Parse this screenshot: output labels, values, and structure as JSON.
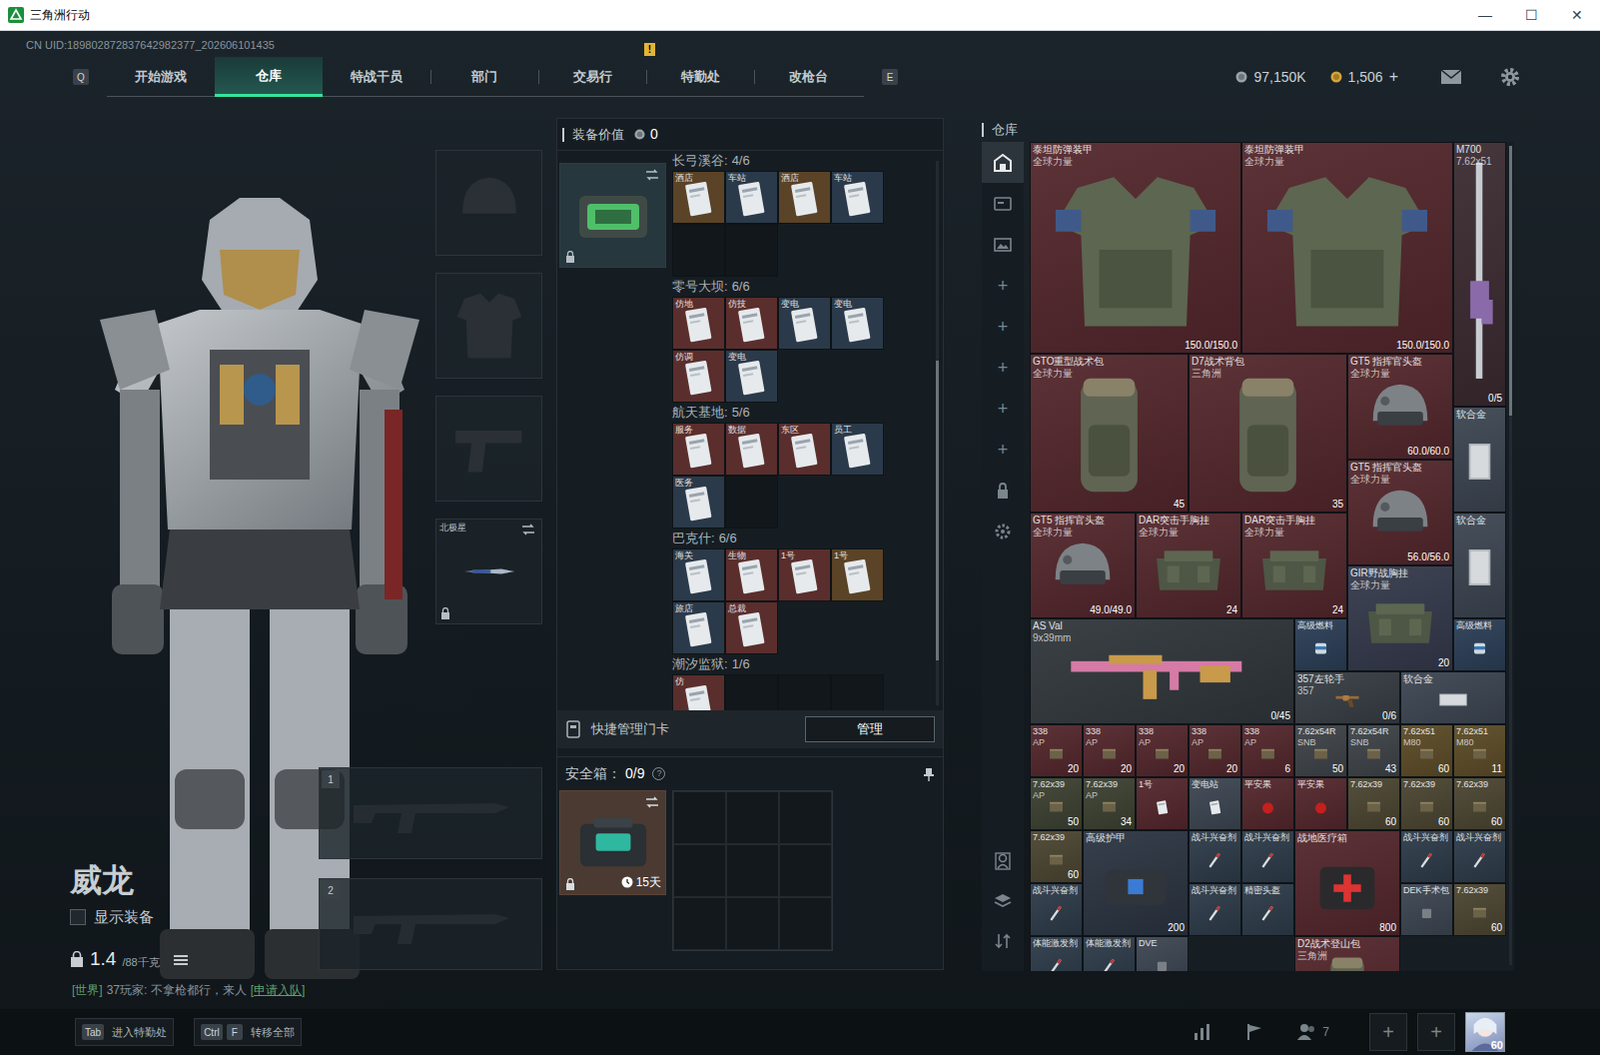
{
  "window": {
    "title": "三角洲行动",
    "controls": [
      "—",
      "☐",
      "✕"
    ]
  },
  "uid": "CN UID:189802872837642982377_202606101435",
  "nav": {
    "left_key": "Q",
    "right_key": "E",
    "tabs": [
      {
        "label": "开始游戏",
        "selected": false,
        "badge": ""
      },
      {
        "label": "仓库",
        "selected": true,
        "badge": ""
      },
      {
        "label": "特战干员",
        "selected": false,
        "badge": ""
      },
      {
        "label": "部门",
        "selected": false,
        "badge": ""
      },
      {
        "label": "交易行",
        "selected": false,
        "badge": ""
      },
      {
        "label": "特勤处",
        "selected": false,
        "badge": "!"
      },
      {
        "label": "改枪台",
        "selected": false,
        "badge": ""
      }
    ]
  },
  "currency": {
    "coins": "97,150K",
    "tickets": "1,506",
    "add": "+"
  },
  "character": {
    "name": "威龙",
    "show_equipment": {
      "label": "显示装备",
      "checked": false
    },
    "weight": "1.4",
    "weight_max": "/88千克"
  },
  "chat": {
    "channel": "[世界]",
    "text": "37玩家: 不拿枪都行，来人",
    "action": "[申请入队]"
  },
  "equipment": {
    "slots": [
      {
        "kind": "helmet",
        "label": "",
        "locked": false
      },
      {
        "kind": "armor",
        "label": "",
        "locked": false
      },
      {
        "kind": "pistol",
        "label": "",
        "locked": false
      },
      {
        "kind": "melee",
        "label": "北极星",
        "locked": true
      }
    ],
    "weapon_slots": [
      {
        "label": "1"
      },
      {
        "label": "2"
      }
    ]
  },
  "loadout": {
    "title": "装备价值",
    "value": "0",
    "keycards": {
      "title": "快捷管理门卡",
      "button": "管理",
      "sections": [
        {
          "title": "长弓溪谷:",
          "count": "4/6",
          "empty_slots": 2,
          "cards": [
            {
              "label": "酒店",
              "color": "#5a4326"
            },
            {
              "label": "车站",
              "color": "#2b3a4a"
            },
            {
              "label": "酒店",
              "color": "#5a4326"
            },
            {
              "label": "车站",
              "color": "#2b3a4a"
            }
          ]
        },
        {
          "title": "零号大坝:",
          "count": "6/6",
          "empty_slots": 0,
          "cards": [
            {
              "label": "仿地",
              "color": "#5a2e2c"
            },
            {
              "label": "仿技",
              "color": "#5a2e2c"
            },
            {
              "label": "变电",
              "color": "#2b3a4a"
            },
            {
              "label": "变电",
              "color": "#2b3a4a"
            },
            {
              "label": "仿调",
              "color": "#5a2e2c"
            },
            {
              "label": "变电",
              "color": "#2b3a4a"
            }
          ]
        },
        {
          "title": "航天基地:",
          "count": "5/6",
          "empty_slots": 1,
          "cards": [
            {
              "label": "服务",
              "color": "#5a2e2c"
            },
            {
              "label": "数据",
              "color": "#5a2e2c"
            },
            {
              "label": "东区",
              "color": "#5a2e2c"
            },
            {
              "label": "员工",
              "color": "#2b3a4a"
            },
            {
              "label": "医务",
              "color": "#2b3a4a"
            }
          ]
        },
        {
          "title": "巴克什:",
          "count": "6/6",
          "empty_slots": 0,
          "cards": [
            {
              "label": "海关",
              "color": "#2b3a4a"
            },
            {
              "label": "生物",
              "color": "#5a2e2c"
            },
            {
              "label": "1号",
              "color": "#5a2e2c"
            },
            {
              "label": "1号",
              "color": "#5a4326"
            },
            {
              "label": "旅店",
              "color": "#2b3a4a"
            },
            {
              "label": "总裁",
              "color": "#5a2e2c"
            }
          ]
        },
        {
          "title": "潮汐监狱:",
          "count": "1/6",
          "empty_slots": 5,
          "cards": [
            {
              "label": "仿",
              "color": "#5a2e2c"
            }
          ]
        }
      ]
    },
    "safe": {
      "title": "安全箱：",
      "count": "0/9",
      "help": "?",
      "timer": "15天",
      "cells": 9
    }
  },
  "warehouse": {
    "title": "仓库",
    "sidebar_top": [
      {
        "kind": "warehouse",
        "label": "",
        "selected": true
      },
      {
        "kind": "card",
        "label": "",
        "selected": false
      },
      {
        "kind": "photo",
        "label": "",
        "selected": false
      },
      {
        "kind": "plus",
        "label": "+",
        "selected": false
      },
      {
        "kind": "plus",
        "label": "+",
        "selected": false
      },
      {
        "kind": "plus",
        "label": "+",
        "selected": false
      },
      {
        "kind": "plus",
        "label": "+",
        "selected": false
      },
      {
        "kind": "plus",
        "label": "+",
        "selected": false
      },
      {
        "kind": "lock",
        "label": "",
        "selected": false
      },
      {
        "kind": "gear",
        "label": "",
        "selected": false
      }
    ],
    "sidebar_bottom": [
      {
        "kind": "person"
      },
      {
        "kind": "layers"
      },
      {
        "kind": "sort"
      }
    ],
    "items": [
      {
        "name": "泰坦防弹装甲",
        "sub": "全球力量",
        "value": "150.0/150.0",
        "color": "#52262b",
        "kind": "armor"
      },
      {
        "name": "泰坦防弹装甲",
        "sub": "全球力量",
        "value": "150.0/150.0",
        "color": "#52262b",
        "kind": "armor"
      },
      {
        "name": "M700",
        "sub": "7.62x51",
        "value": "0/5",
        "color": "#3a2a30",
        "kind": "rifle_v"
      },
      {
        "name": "GTO重型战术包",
        "sub": "全球力量",
        "value": "45",
        "color": "#52262b",
        "kind": "backpack"
      },
      {
        "name": "D7战术背包",
        "sub": "三角洲",
        "value": "35",
        "color": "#52262b",
        "kind": "backpack"
      },
      {
        "name": "GT5 指挥官头盔",
        "sub": "全球力量",
        "value": "60.0/60.0",
        "color": "#52262b",
        "kind": "helmet"
      },
      {
        "name": "软合金",
        "sub": "",
        "value": "",
        "color": "#3b4450",
        "kind": "plate"
      },
      {
        "name": "GT5 指挥官头盔",
        "sub": "全球力量",
        "value": "56.0/56.0",
        "color": "#52262b",
        "kind": "helmet"
      },
      {
        "name": "GT5 指挥官头盔",
        "sub": "全球力量",
        "value": "49.0/49.0",
        "color": "#52262b",
        "kind": "helmet"
      },
      {
        "name": "DAR突击手胸挂",
        "sub": "全球力量",
        "value": "24",
        "color": "#52262b",
        "kind": "rig"
      },
      {
        "name": "DAR突击手胸挂",
        "sub": "全球力量",
        "value": "24",
        "color": "#52262b",
        "kind": "rig"
      },
      {
        "name": "软合金",
        "sub": "",
        "value": "",
        "color": "#3b4450",
        "kind": "plate"
      },
      {
        "name": "GIR野战胸挂",
        "sub": "全球力量",
        "value": "20",
        "color": "#33384a",
        "kind": "rig"
      },
      {
        "name": "AS Val",
        "sub": "9x39mm",
        "value": "0/45",
        "color": "#2f353a",
        "kind": "rifle"
      },
      {
        "name": "高级燃料",
        "sub": "",
        "value": "",
        "color": "#2a3d55",
        "kind": "fuel"
      },
      {
        "name": "高级燃料",
        "sub": "",
        "value": "",
        "color": "#2a3d55",
        "kind": "fuel"
      },
      {
        "name": "357左轮手",
        "sub": "357",
        "value": "0/6",
        "color": "#353c42",
        "kind": "pistol"
      },
      {
        "name": "软合金",
        "sub": "",
        "value": "",
        "color": "#3b4450",
        "kind": "plate_h"
      },
      {
        "name": "338",
        "sub": "AP",
        "value": "20",
        "color": "#52262b",
        "kind": "ammo"
      },
      {
        "name": "338",
        "sub": "AP",
        "value": "20",
        "color": "#52262b",
        "kind": "ammo"
      },
      {
        "name": "338",
        "sub": "AP",
        "value": "20",
        "color": "#52262b",
        "kind": "ammo"
      },
      {
        "name": "338",
        "sub": "AP",
        "value": "20",
        "color": "#52262b",
        "kind": "ammo"
      },
      {
        "name": "338",
        "sub": "AP",
        "value": "6",
        "color": "#52262b",
        "kind": "ammo"
      },
      {
        "name": "7.62x54R",
        "sub": "SNB",
        "value": "50",
        "color": "#3d4247",
        "kind": "ammo"
      },
      {
        "name": "7.62x54R",
        "sub": "SNB",
        "value": "43",
        "color": "#3d4247",
        "kind": "ammo"
      },
      {
        "name": "7.62x51",
        "sub": "M80",
        "value": "60",
        "color": "#5a4a26",
        "kind": "ammo"
      },
      {
        "name": "7.62x51",
        "sub": "M80",
        "value": "11",
        "color": "#5a4a26",
        "kind": "ammo"
      },
      {
        "name": "7.62x39",
        "sub": "AP",
        "value": "50",
        "color": "#3b4030",
        "kind": "ammo"
      },
      {
        "name": "7.62x39",
        "sub": "AP",
        "value": "34",
        "color": "#3b4030",
        "kind": "ammo"
      },
      {
        "name": "1号",
        "sub": "",
        "value": "",
        "color": "#52262b",
        "kind": "keycard"
      },
      {
        "name": "变电站",
        "sub": "",
        "value": "",
        "color": "#3b4450",
        "kind": "keycard"
      },
      {
        "name": "平安果",
        "sub": "",
        "value": "",
        "color": "#52262b",
        "kind": "food"
      },
      {
        "name": "平安果",
        "sub": "",
        "value": "",
        "color": "#52262b",
        "kind": "food"
      },
      {
        "name": "7.62x39",
        "sub": "",
        "value": "60",
        "color": "#4a4430",
        "kind": "ammo"
      },
      {
        "name": "7.62x39",
        "sub": "",
        "value": "60",
        "color": "#4a4430",
        "kind": "ammo"
      },
      {
        "name": "7.62x39",
        "sub": "",
        "value": "60",
        "color": "#4a4430",
        "kind": "ammo"
      },
      {
        "name": "7.62x39",
        "sub": "",
        "value": "60",
        "color": "#4a4430",
        "kind": "ammo"
      },
      {
        "name": "高级护甲",
        "sub": "",
        "value": "200",
        "color": "#2a3340",
        "kind": "repair"
      },
      {
        "name": "战斗兴奋剂",
        "sub": "",
        "value": "",
        "color": "#2c3a48",
        "kind": "stim"
      },
      {
        "name": "战斗兴奋剂",
        "sub": "",
        "value": "",
        "color": "#2c3a48",
        "kind": "stim"
      },
      {
        "name": "战地医疗箱",
        "sub": "",
        "value": "800",
        "color": "#52262b",
        "kind": "medkit"
      },
      {
        "name": "战斗兴奋剂",
        "sub": "",
        "value": "",
        "color": "#2c3a48",
        "kind": "stim"
      },
      {
        "name": "战斗兴奋剂",
        "sub": "",
        "value": "",
        "color": "#2c3a48",
        "kind": "stim"
      },
      {
        "name": "战斗兴奋剂",
        "sub": "",
        "value": "",
        "color": "#2c3a48",
        "kind": "stim"
      },
      {
        "name": "战斗兴奋剂",
        "sub": "",
        "value": "",
        "color": "#2c3a48",
        "kind": "stim"
      },
      {
        "name": "精密头盔",
        "sub": "",
        "value": "",
        "color": "#2c3a48",
        "kind": "stim"
      },
      {
        "name": "DEK手术包",
        "sub": "",
        "value": "",
        "color": "#3b4450",
        "kind": "misc"
      },
      {
        "name": "7.62x39",
        "sub": "",
        "value": "60",
        "color": "#4a4430",
        "kind": "ammo"
      },
      {
        "name": "体能激发剂",
        "sub": "",
        "value": "",
        "color": "#2c3a48",
        "kind": "stim"
      },
      {
        "name": "体能激发剂",
        "sub": "",
        "value": "",
        "color": "#2c3a48",
        "kind": "stim"
      },
      {
        "name": "DVE",
        "sub": "",
        "value": "",
        "color": "#3b4450",
        "kind": "misc"
      },
      {
        "name": "D2战术登山包",
        "sub": "三角洲",
        "value": "",
        "color": "#52262b",
        "kind": "backpack"
      }
    ]
  },
  "bottom_bar": {
    "hints": [
      {
        "keys": [
          "Tab"
        ],
        "label": "进入特勤处"
      },
      {
        "keys": [
          "Ctrl",
          "F"
        ],
        "label": "转移全部"
      }
    ],
    "friends": "7",
    "add_buttons": [
      "+",
      "+"
    ],
    "level": "60"
  }
}
